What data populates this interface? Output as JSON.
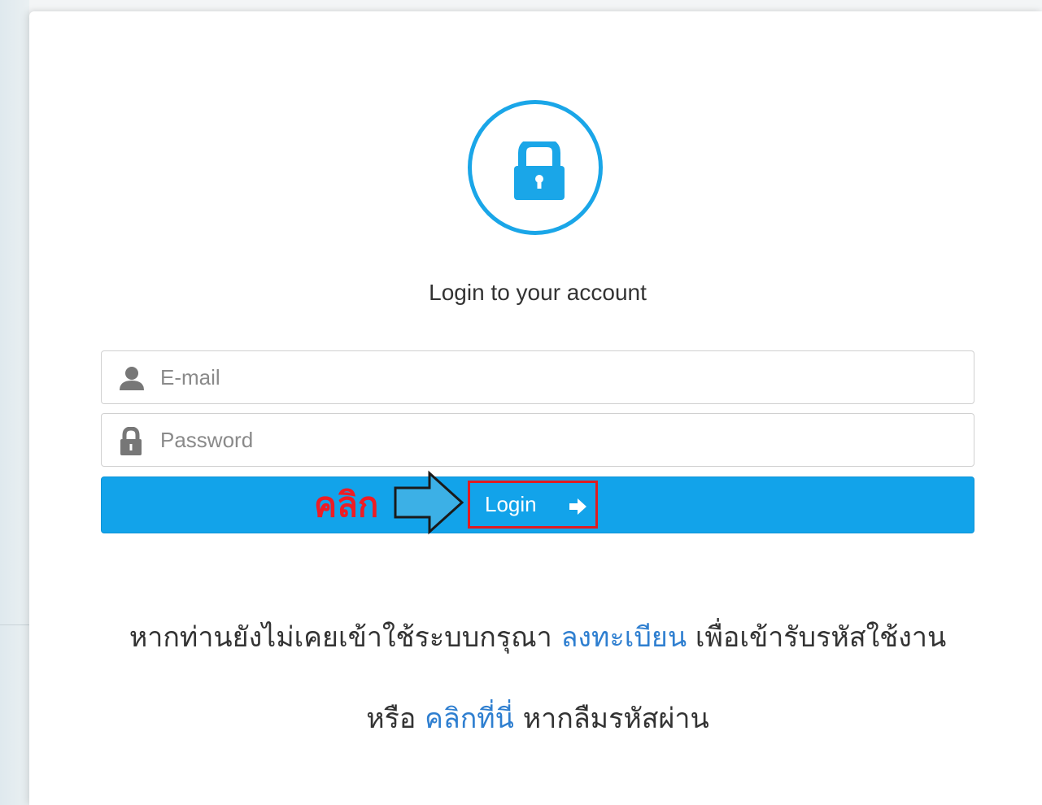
{
  "login": {
    "title": "Login to your account",
    "email_placeholder": "E-mail",
    "password_placeholder": "Password",
    "button_label": "Login"
  },
  "annotation": {
    "click_label": "คลิก"
  },
  "help": {
    "line1_prefix": "หากท่านยังไม่เคยเข้าใช้ระบบกรุณา",
    "register_link": "ลงทะเบียน",
    "line1_suffix": "เพื่อเข้ารับรหัสใช้งาน",
    "line2_prefix": "หรือ",
    "reset_link": "คลิกที่นี่",
    "line2_suffix": "หากลืมรหัสผ่าน"
  },
  "colors": {
    "accent": "#12a3ea",
    "annotation_red": "#ee1c24",
    "link": "#2f7fd0"
  },
  "icons": {
    "header": "lock-icon",
    "email": "user-icon",
    "password": "lock-icon",
    "button": "arrow-right-icon"
  }
}
